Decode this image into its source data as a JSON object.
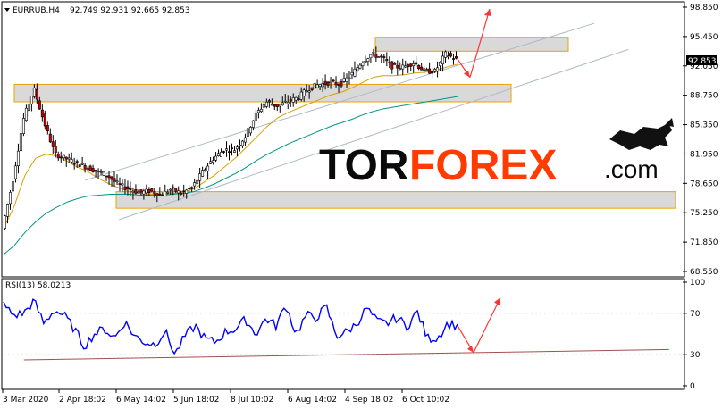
{
  "chart_data": [
    {
      "type": "candlestick",
      "symbol": "EURRUB,H4",
      "ohlc_text": "92.749 92.931 92.665 92.853",
      "current_price_label": "92.853",
      "y_axis": {
        "ticks": [
          "98.850",
          "95.450",
          "92.050",
          "88.750",
          "85.350",
          "81.950",
          "78.650",
          "75.250",
          "71.850",
          "68.550"
        ],
        "range": [
          68.55,
          98.85
        ]
      },
      "x_axis": {
        "ticks": [
          "3 Mar 2020",
          "2 Apr 18:02",
          "6 May 14:02",
          "5 Jun 18:02",
          "8 Jul 10:02",
          "6 Aug 14:02",
          "4 Sep 18:02",
          "6 Oct 10:02"
        ]
      },
      "price_path": [
        73.5,
        79.0,
        86.0,
        89.5,
        85.5,
        82.0,
        81.5,
        81.0,
        80.5,
        80.0,
        79.5,
        78.5,
        78.0,
        77.6,
        77.8,
        77.3,
        78.0,
        77.5,
        78.2,
        80.0,
        81.5,
        82.5,
        82.5,
        84.0,
        86.5,
        88.0,
        87.5,
        88.0,
        88.5,
        89.5,
        90.0,
        90.2,
        90.0,
        91.0,
        92.5,
        93.5,
        93.0,
        92.0,
        92.0,
        92.5,
        91.5,
        91.5,
        93.5,
        92.85
      ],
      "ma_fast": [
        73.5,
        76.0,
        79.5,
        81.5,
        82.0,
        81.8,
        81.2,
        80.5,
        80.0,
        79.2,
        78.6,
        78.1,
        77.7,
        77.5,
        77.4,
        77.4,
        77.5,
        77.6,
        78.0,
        78.8,
        79.6,
        80.6,
        81.6,
        82.8,
        84.0,
        85.2,
        86.2,
        86.8,
        87.3,
        87.8,
        88.3,
        88.8,
        89.1,
        89.6,
        90.2,
        90.8,
        91.0,
        91.0,
        91.1,
        91.3,
        91.4,
        91.6,
        92.0,
        92.3
      ],
      "ma_slow": [
        70.5,
        71.5,
        73.0,
        74.2,
        75.2,
        75.9,
        76.5,
        76.9,
        77.2,
        77.3,
        77.4,
        77.4,
        77.4,
        77.3,
        77.3,
        77.3,
        77.4,
        77.5,
        77.7,
        78.1,
        78.6,
        79.2,
        79.8,
        80.5,
        81.3,
        82.0,
        82.6,
        83.2,
        83.7,
        84.2,
        84.7,
        85.2,
        85.6,
        86.0,
        86.5,
        86.9,
        87.2,
        87.4,
        87.6,
        87.8,
        88.0,
        88.2,
        88.4,
        88.6
      ],
      "zones": [
        {
          "from": 93.8,
          "to": 95.4
        },
        {
          "from": 88.0,
          "to": 90.0
        },
        {
          "from": 75.8,
          "to": 77.7
        }
      ],
      "channel": {
        "upper": [
          [
            0.12,
            79.0
          ],
          [
            0.87,
            97.0
          ]
        ],
        "lower": [
          [
            0.17,
            74.5
          ],
          [
            0.92,
            94.0
          ]
        ],
        "mid": [
          [
            0.0,
            85.4
          ],
          [
            0.05,
            86.1
          ]
        ]
      },
      "forecast": {
        "from": 92.9,
        "dip": 90.8,
        "target": 98.85
      }
    },
    {
      "type": "line",
      "title": "RSI(13) 58.0213",
      "y_axis": {
        "ticks": [
          "100",
          "70",
          "30",
          "0"
        ],
        "range": [
          0,
          100
        ]
      },
      "values": [
        78,
        68,
        70,
        82,
        60,
        73,
        68,
        55,
        38,
        50,
        55,
        46,
        62,
        48,
        42,
        40,
        53,
        30,
        48,
        58,
        45,
        42,
        52,
        55,
        64,
        50,
        65,
        58,
        78,
        50,
        68,
        66,
        76,
        48,
        52,
        60,
        75,
        62,
        60,
        66,
        57,
        72,
        46,
        46,
        60,
        58
      ],
      "trendline": [
        [
          0.03,
          25
        ],
        [
          0.98,
          35
        ]
      ],
      "forecast": {
        "from": 58,
        "dip": 32,
        "target": 85
      }
    }
  ],
  "watermark": {
    "tor": "TOR",
    "forex": "FOREX",
    "dotcom": ".com"
  },
  "colors": {
    "candle": "#000000",
    "bear": "#cc0000",
    "bull": "#ffffff",
    "ma_fast": "#d8a000",
    "ma_slow": "#009688",
    "rsi": "#0000ff",
    "zone_fill": "#d9d9d9",
    "zone_border": "#e8a500",
    "channel": "#b0bac5",
    "arrow": "#ff3333"
  }
}
